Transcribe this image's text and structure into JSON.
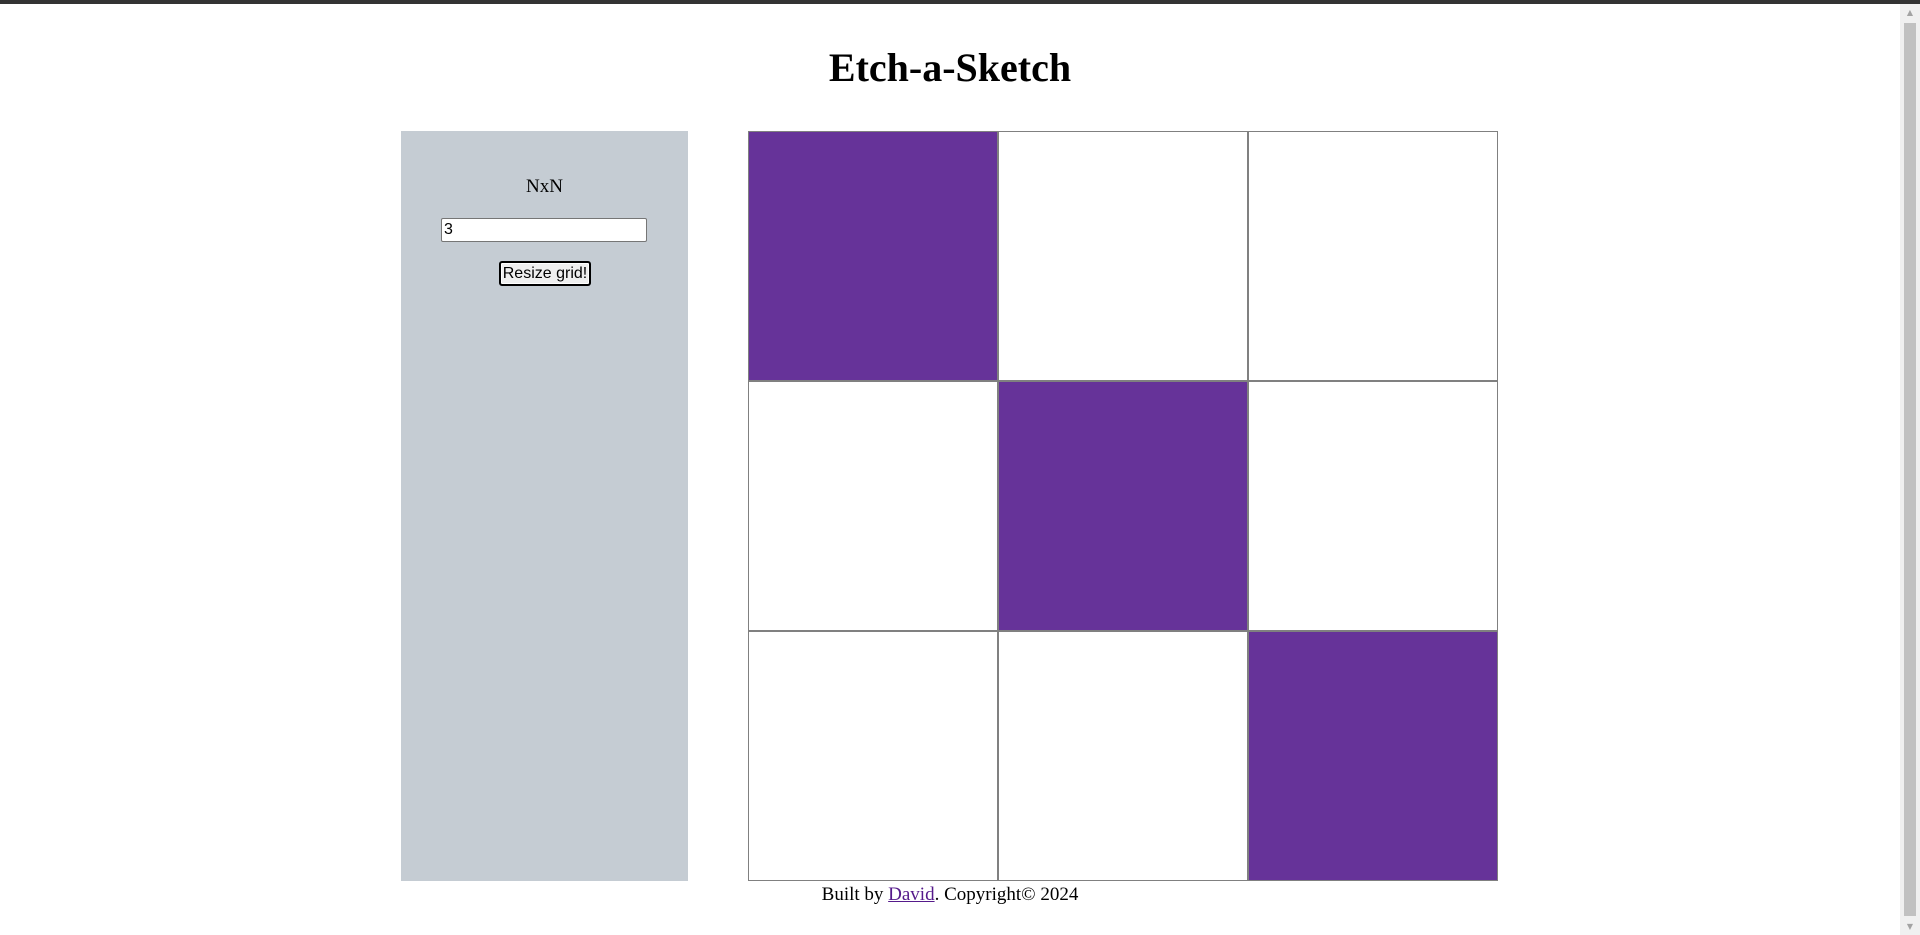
{
  "page": {
    "title": "Etch-a-Sketch"
  },
  "controls": {
    "label": "NxN",
    "size_value": "3",
    "resize_button_label": "Resize grid!"
  },
  "grid": {
    "size": 3,
    "paint_color": "#663399",
    "painted_cells": [
      0,
      4,
      8
    ]
  },
  "footer": {
    "prefix": "Built by ",
    "author_link": "David",
    "suffix": ". Copyright© 2024"
  },
  "colors": {
    "panel_background": "#c5ccd3",
    "cell_border": "#808080",
    "link": "#551a8b"
  }
}
